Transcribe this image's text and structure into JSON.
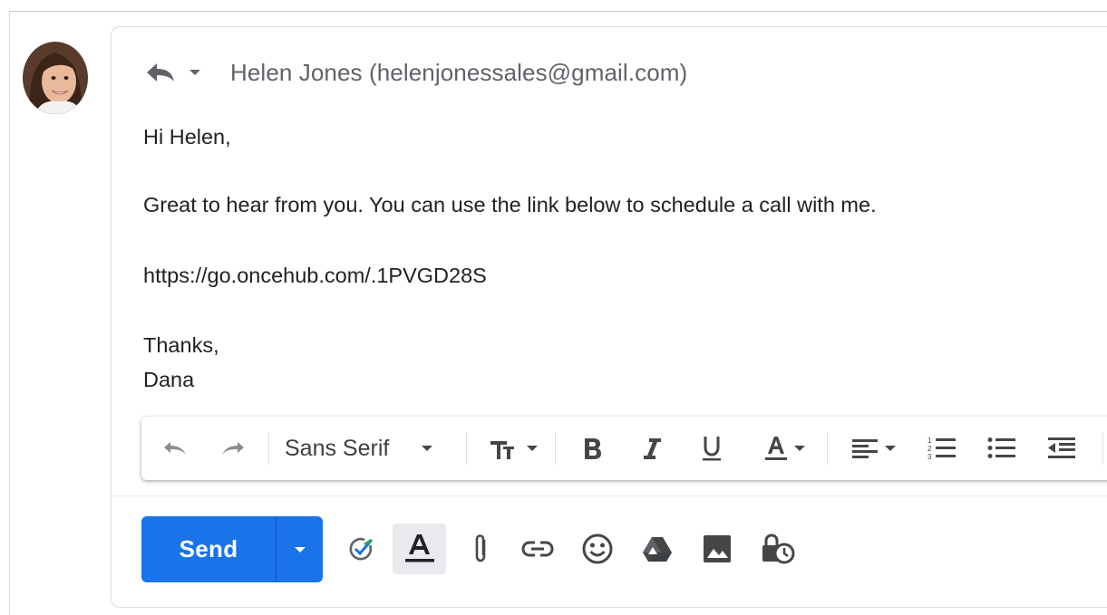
{
  "message": {
    "recipient": "Helen Jones (helenjonessales@gmail.com)",
    "greeting": "Hi Helen,",
    "paragraph": "Great to hear from you. You can use the link below to schedule a call with me.",
    "link": "https://go.oncehub.com/.1PVGD28S",
    "closing": "Thanks,",
    "signature": "Dana"
  },
  "format_toolbar": {
    "font": "Sans Serif"
  },
  "compose_actions": {
    "send_label": "Send"
  },
  "colors": {
    "accent": "#1a73e8",
    "icon": "#444746",
    "recipient_text": "#5f6368"
  },
  "icons": [
    "reply-icon",
    "dropdown-caret-icon",
    "undo-icon",
    "redo-icon",
    "text-size-icon",
    "bold-icon",
    "italic-icon",
    "underline-icon",
    "text-color-icon",
    "align-icon",
    "numbered-list-icon",
    "bulleted-list-icon",
    "indent-less-icon",
    "checkmark-icon",
    "text-formatting-icon",
    "attach-icon",
    "link-icon",
    "emoji-icon",
    "drive-icon",
    "photo-icon",
    "confidential-mode-icon"
  ]
}
